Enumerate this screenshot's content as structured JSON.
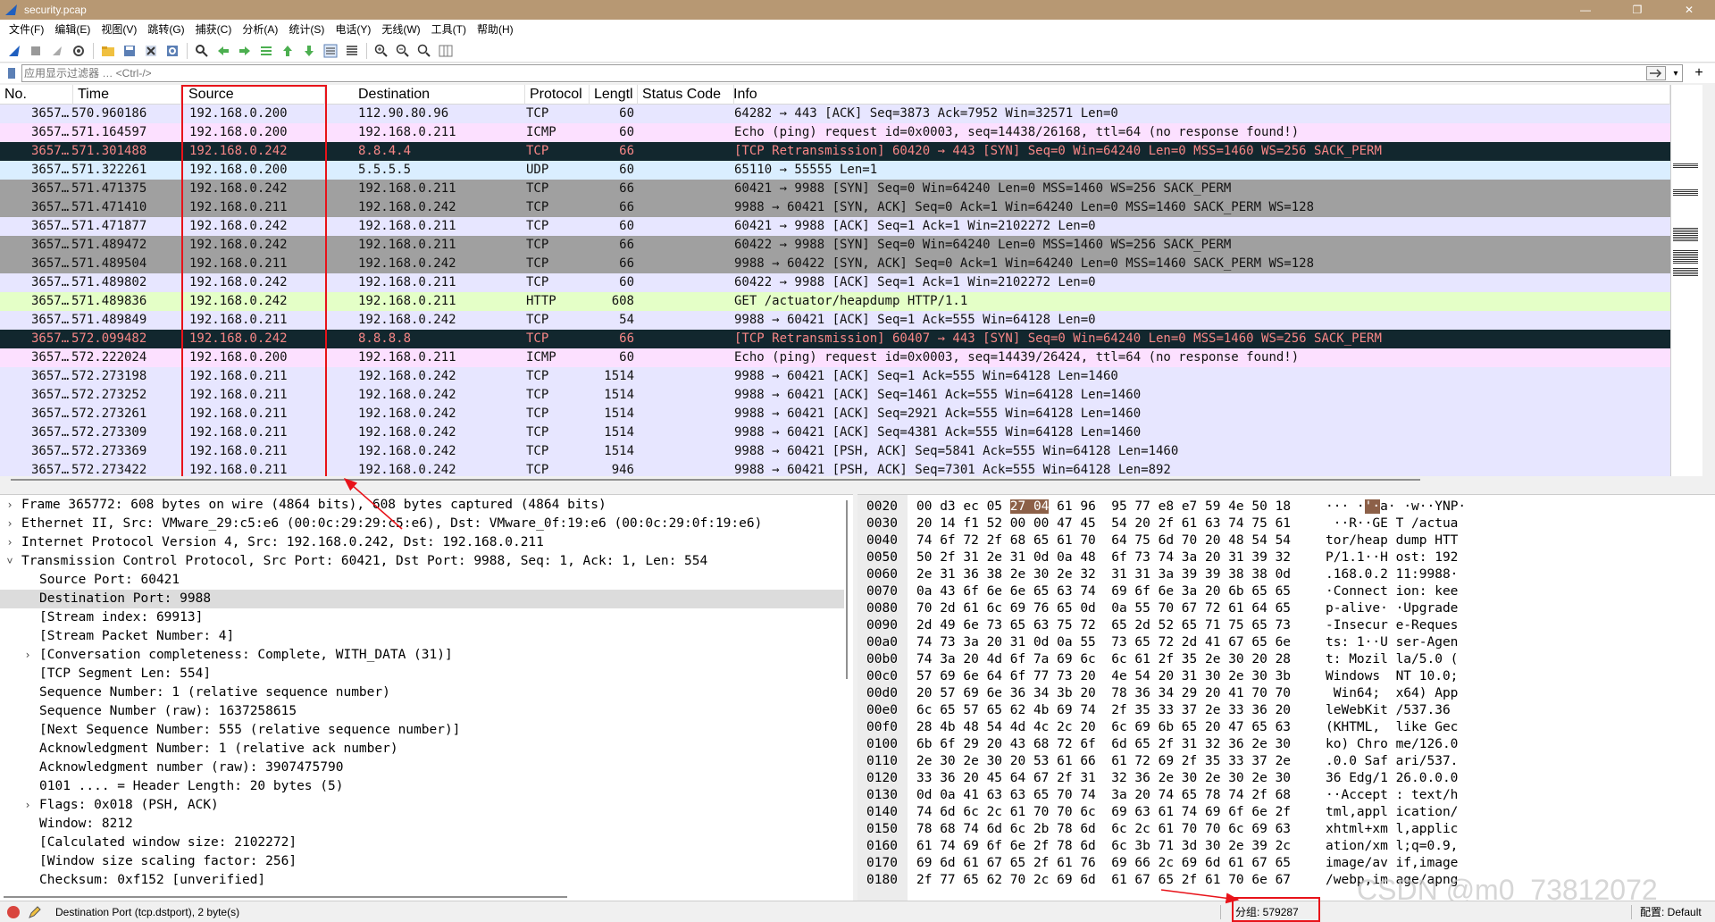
{
  "window": {
    "title": "security.pcap",
    "controls": [
      "—",
      "❐",
      "✕"
    ]
  },
  "menu": [
    "文件(F)",
    "编辑(E)",
    "视图(V)",
    "跳转(G)",
    "捕获(C)",
    "分析(A)",
    "统计(S)",
    "电话(Y)",
    "无线(W)",
    "工具(T)",
    "帮助(H)"
  ],
  "filter": {
    "placeholder": "应用显示过滤器 … <Ctrl-/>",
    "value": ""
  },
  "columns": [
    "No.",
    "Time",
    "Source",
    "Destination",
    "Protocol",
    "Lengtl",
    "Status Code",
    "Info"
  ],
  "packets": [
    {
      "no": "3657…",
      "time": "570.960186",
      "src": "192.168.0.200",
      "dst": "112.90.80.96",
      "proto": "TCP",
      "len": "60",
      "info": "64282 → 443 [ACK] Seq=3873 Ack=7952 Win=32571 Len=0",
      "style": "tcp"
    },
    {
      "no": "3657…",
      "time": "571.164597",
      "src": "192.168.0.200",
      "dst": "192.168.0.211",
      "proto": "ICMP",
      "len": "60",
      "info": "Echo (ping) request  id=0x0003, seq=14438/26168, ttl=64 (no response found!)",
      "style": "icmp"
    },
    {
      "no": "3657…",
      "time": "571.301488",
      "src": "192.168.0.242",
      "dst": "8.8.4.4",
      "proto": "TCP",
      "len": "66",
      "info": "[TCP Retransmission] 60420 → 443 [SYN] Seq=0 Win=64240 Len=0 MSS=1460 WS=256 SACK_PERM",
      "style": "bad"
    },
    {
      "no": "3657…",
      "time": "571.322261",
      "src": "192.168.0.200",
      "dst": "5.5.5.5",
      "proto": "UDP",
      "len": "60",
      "info": "65110 → 55555 Len=1",
      "style": "udp"
    },
    {
      "no": "3657…",
      "time": "571.471375",
      "src": "192.168.0.242",
      "dst": "192.168.0.211",
      "proto": "TCP",
      "len": "66",
      "info": "60421 → 9988 [SYN] Seq=0 Win=64240 Len=0 MSS=1460 WS=256 SACK_PERM",
      "style": "syn"
    },
    {
      "no": "3657…",
      "time": "571.471410",
      "src": "192.168.0.211",
      "dst": "192.168.0.242",
      "proto": "TCP",
      "len": "66",
      "info": "9988 → 60421 [SYN, ACK] Seq=0 Ack=1 Win=64240 Len=0 MSS=1460 SACK_PERM WS=128",
      "style": "syn"
    },
    {
      "no": "3657…",
      "time": "571.471877",
      "src": "192.168.0.242",
      "dst": "192.168.0.211",
      "proto": "TCP",
      "len": "60",
      "info": "60421 → 9988 [ACK] Seq=1 Ack=1 Win=2102272 Len=0",
      "style": "tcp"
    },
    {
      "no": "3657…",
      "time": "571.489472",
      "src": "192.168.0.242",
      "dst": "192.168.0.211",
      "proto": "TCP",
      "len": "66",
      "info": "60422 → 9988 [SYN] Seq=0 Win=64240 Len=0 MSS=1460 WS=256 SACK_PERM",
      "style": "syn"
    },
    {
      "no": "3657…",
      "time": "571.489504",
      "src": "192.168.0.211",
      "dst": "192.168.0.242",
      "proto": "TCP",
      "len": "66",
      "info": "9988 → 60422 [SYN, ACK] Seq=0 Ack=1 Win=64240 Len=0 MSS=1460 SACK_PERM WS=128",
      "style": "syn"
    },
    {
      "no": "3657…",
      "time": "571.489802",
      "src": "192.168.0.242",
      "dst": "192.168.0.211",
      "proto": "TCP",
      "len": "60",
      "info": "60422 → 9988 [ACK] Seq=1 Ack=1 Win=2102272 Len=0",
      "style": "tcp"
    },
    {
      "no": "3657…",
      "time": "571.489836",
      "src": "192.168.0.242",
      "dst": "192.168.0.211",
      "proto": "HTTP",
      "len": "608",
      "info": "GET /actuator/heapdump HTTP/1.1",
      "style": "http"
    },
    {
      "no": "3657…",
      "time": "571.489849",
      "src": "192.168.0.211",
      "dst": "192.168.0.242",
      "proto": "TCP",
      "len": "54",
      "info": "9988 → 60421 [ACK] Seq=1 Ack=555 Win=64128 Len=0",
      "style": "tcp"
    },
    {
      "no": "3657…",
      "time": "572.099482",
      "src": "192.168.0.242",
      "dst": "8.8.8.8",
      "proto": "TCP",
      "len": "66",
      "info": "[TCP Retransmission] 60407 → 443 [SYN] Seq=0 Win=64240 Len=0 MSS=1460 WS=256 SACK_PERM",
      "style": "bad"
    },
    {
      "no": "3657…",
      "time": "572.222024",
      "src": "192.168.0.200",
      "dst": "192.168.0.211",
      "proto": "ICMP",
      "len": "60",
      "info": "Echo (ping) request  id=0x0003, seq=14439/26424, ttl=64 (no response found!)",
      "style": "icmp"
    },
    {
      "no": "3657…",
      "time": "572.273198",
      "src": "192.168.0.211",
      "dst": "192.168.0.242",
      "proto": "TCP",
      "len": "1514",
      "info": "9988 → 60421 [ACK] Seq=1 Ack=555 Win=64128 Len=1460",
      "style": "tcp"
    },
    {
      "no": "3657…",
      "time": "572.273252",
      "src": "192.168.0.211",
      "dst": "192.168.0.242",
      "proto": "TCP",
      "len": "1514",
      "info": "9988 → 60421 [ACK] Seq=1461 Ack=555 Win=64128 Len=1460",
      "style": "tcp"
    },
    {
      "no": "3657…",
      "time": "572.273261",
      "src": "192.168.0.211",
      "dst": "192.168.0.242",
      "proto": "TCP",
      "len": "1514",
      "info": "9988 → 60421 [ACK] Seq=2921 Ack=555 Win=64128 Len=1460",
      "style": "tcp"
    },
    {
      "no": "3657…",
      "time": "572.273309",
      "src": "192.168.0.211",
      "dst": "192.168.0.242",
      "proto": "TCP",
      "len": "1514",
      "info": "9988 → 60421 [ACK] Seq=4381 Ack=555 Win=64128 Len=1460",
      "style": "tcp"
    },
    {
      "no": "3657…",
      "time": "572.273369",
      "src": "192.168.0.211",
      "dst": "192.168.0.242",
      "proto": "TCP",
      "len": "1514",
      "info": "9988 → 60421 [PSH, ACK] Seq=5841 Ack=555 Win=64128 Len=1460",
      "style": "tcp"
    },
    {
      "no": "3657…",
      "time": "572.273422",
      "src": "192.168.0.211",
      "dst": "192.168.0.242",
      "proto": "TCP",
      "len": "946",
      "info": "9988 → 60421 [PSH, ACK] Seq=7301 Ack=555 Win=64128 Len=892",
      "style": "tcp"
    }
  ],
  "details": [
    {
      "indent": 0,
      "expander": "›",
      "text": "Frame 365772: 608 bytes on wire (4864 bits), 608 bytes captured (4864 bits)"
    },
    {
      "indent": 0,
      "expander": "›",
      "text": "Ethernet II, Src: VMware_29:c5:e6 (00:0c:29:29:c5:e6), Dst: VMware_0f:19:e6 (00:0c:29:0f:19:e6)"
    },
    {
      "indent": 0,
      "expander": "›",
      "text": "Internet Protocol Version 4, Src: 192.168.0.242, Dst: 192.168.0.211"
    },
    {
      "indent": 0,
      "expander": "˅",
      "text": "Transmission Control Protocol, Src Port: 60421, Dst Port: 9988, Seq: 1, Ack: 1, Len: 554"
    },
    {
      "indent": 1,
      "expander": "",
      "text": "Source Port: 60421"
    },
    {
      "indent": 1,
      "expander": "",
      "text": "Destination Port: 9988",
      "selected": true
    },
    {
      "indent": 1,
      "expander": "",
      "text": "[Stream index: 69913]"
    },
    {
      "indent": 1,
      "expander": "",
      "text": "[Stream Packet Number: 4]"
    },
    {
      "indent": 1,
      "expander": "›",
      "text": "[Conversation completeness: Complete, WITH_DATA (31)]"
    },
    {
      "indent": 1,
      "expander": "",
      "text": "[TCP Segment Len: 554]"
    },
    {
      "indent": 1,
      "expander": "",
      "text": "Sequence Number: 1    (relative sequence number)"
    },
    {
      "indent": 1,
      "expander": "",
      "text": "Sequence Number (raw): 1637258615"
    },
    {
      "indent": 1,
      "expander": "",
      "text": "[Next Sequence Number: 555    (relative sequence number)]"
    },
    {
      "indent": 1,
      "expander": "",
      "text": "Acknowledgment Number: 1    (relative ack number)"
    },
    {
      "indent": 1,
      "expander": "",
      "text": "Acknowledgment number (raw): 3907475790"
    },
    {
      "indent": 1,
      "expander": "",
      "text": "0101 .... = Header Length: 20 bytes (5)"
    },
    {
      "indent": 1,
      "expander": "›",
      "text": "Flags: 0x018 (PSH, ACK)"
    },
    {
      "indent": 1,
      "expander": "",
      "text": "Window: 8212"
    },
    {
      "indent": 1,
      "expander": "",
      "text": "[Calculated window size: 2102272]"
    },
    {
      "indent": 1,
      "expander": "",
      "text": "[Window size scaling factor: 256]"
    },
    {
      "indent": 1,
      "expander": "",
      "text": "Checksum: 0xf152 [unverified]"
    }
  ],
  "hex": [
    {
      "offset": "0020",
      "pre": "00 d3 ec 05 ",
      "hl": "27 04",
      "post": " 61 96  95 77 e8 e7 59 4e 50 18",
      "apre": "··· ·",
      "ahl": "'·",
      "apost": "a· ·w··YNP·"
    },
    {
      "offset": "0030",
      "pre": "20 14 f1 52 00 00 47 45  54 20 2f 61 63 74 75 61",
      "hl": "",
      "post": "",
      "apre": " ··R··GE T /actua",
      "ahl": "",
      "apost": ""
    },
    {
      "offset": "0040",
      "pre": "74 6f 72 2f 68 65 61 70  64 75 6d 70 20 48 54 54",
      "hl": "",
      "post": "",
      "apre": "tor/heap dump HTT",
      "ahl": "",
      "apost": ""
    },
    {
      "offset": "0050",
      "pre": "50 2f 31 2e 31 0d 0a 48  6f 73 74 3a 20 31 39 32",
      "hl": "",
      "post": "",
      "apre": "P/1.1··H ost: 192",
      "ahl": "",
      "apost": ""
    },
    {
      "offset": "0060",
      "pre": "2e 31 36 38 2e 30 2e 32  31 31 3a 39 39 38 38 0d",
      "hl": "",
      "post": "",
      "apre": ".168.0.2 11:9988·",
      "ahl": "",
      "apost": ""
    },
    {
      "offset": "0070",
      "pre": "0a 43 6f 6e 6e 65 63 74  69 6f 6e 3a 20 6b 65 65",
      "hl": "",
      "post": "",
      "apre": "·Connect ion: kee",
      "ahl": "",
      "apost": ""
    },
    {
      "offset": "0080",
      "pre": "70 2d 61 6c 69 76 65 0d  0a 55 70 67 72 61 64 65",
      "hl": "",
      "post": "",
      "apre": "p-alive· ·Upgrade",
      "ahl": "",
      "apost": ""
    },
    {
      "offset": "0090",
      "pre": "2d 49 6e 73 65 63 75 72  65 2d 52 65 71 75 65 73",
      "hl": "",
      "post": "",
      "apre": "-Insecur e-Reques",
      "ahl": "",
      "apost": ""
    },
    {
      "offset": "00a0",
      "pre": "74 73 3a 20 31 0d 0a 55  73 65 72 2d 41 67 65 6e",
      "hl": "",
      "post": "",
      "apre": "ts: 1··U ser-Agen",
      "ahl": "",
      "apost": ""
    },
    {
      "offset": "00b0",
      "pre": "74 3a 20 4d 6f 7a 69 6c  6c 61 2f 35 2e 30 20 28",
      "hl": "",
      "post": "",
      "apre": "t: Mozil la/5.0 (",
      "ahl": "",
      "apost": ""
    },
    {
      "offset": "00c0",
      "pre": "57 69 6e 64 6f 77 73 20  4e 54 20 31 30 2e 30 3b",
      "hl": "",
      "post": "",
      "apre": "Windows  NT 10.0;",
      "ahl": "",
      "apost": ""
    },
    {
      "offset": "00d0",
      "pre": "20 57 69 6e 36 34 3b 20  78 36 34 29 20 41 70 70",
      "hl": "",
      "post": "",
      "apre": " Win64;  x64) App",
      "ahl": "",
      "apost": ""
    },
    {
      "offset": "00e0",
      "pre": "6c 65 57 65 62 4b 69 74  2f 35 33 37 2e 33 36 20",
      "hl": "",
      "post": "",
      "apre": "leWebKit /537.36 ",
      "ahl": "",
      "apost": ""
    },
    {
      "offset": "00f0",
      "pre": "28 4b 48 54 4d 4c 2c 20  6c 69 6b 65 20 47 65 63",
      "hl": "",
      "post": "",
      "apre": "(KHTML,  like Gec",
      "ahl": "",
      "apost": ""
    },
    {
      "offset": "0100",
      "pre": "6b 6f 29 20 43 68 72 6f  6d 65 2f 31 32 36 2e 30",
      "hl": "",
      "post": "",
      "apre": "ko) Chro me/126.0",
      "ahl": "",
      "apost": ""
    },
    {
      "offset": "0110",
      "pre": "2e 30 2e 30 20 53 61 66  61 72 69 2f 35 33 37 2e",
      "hl": "",
      "post": "",
      "apre": ".0.0 Saf ari/537.",
      "ahl": "",
      "apost": ""
    },
    {
      "offset": "0120",
      "pre": "33 36 20 45 64 67 2f 31  32 36 2e 30 2e 30 2e 30",
      "hl": "",
      "post": "",
      "apre": "36 Edg/1 26.0.0.0",
      "ahl": "",
      "apost": ""
    },
    {
      "offset": "0130",
      "pre": "0d 0a 41 63 63 65 70 74  3a 20 74 65 78 74 2f 68",
      "hl": "",
      "post": "",
      "apre": "··Accept : text/h",
      "ahl": "",
      "apost": ""
    },
    {
      "offset": "0140",
      "pre": "74 6d 6c 2c 61 70 70 6c  69 63 61 74 69 6f 6e 2f",
      "hl": "",
      "post": "",
      "apre": "tml,appl ication/",
      "ahl": "",
      "apost": ""
    },
    {
      "offset": "0150",
      "pre": "78 68 74 6d 6c 2b 78 6d  6c 2c 61 70 70 6c 69 63",
      "hl": "",
      "post": "",
      "apre": "xhtml+xm l,applic",
      "ahl": "",
      "apost": ""
    },
    {
      "offset": "0160",
      "pre": "61 74 69 6f 6e 2f 78 6d  6c 3b 71 3d 30 2e 39 2c",
      "hl": "",
      "post": "",
      "apre": "ation/xm l;q=0.9,",
      "ahl": "",
      "apost": ""
    },
    {
      "offset": "0170",
      "pre": "69 6d 61 67 65 2f 61 76  69 66 2c 69 6d 61 67 65",
      "hl": "",
      "post": "",
      "apre": "image/av if,image",
      "ahl": "",
      "apost": ""
    },
    {
      "offset": "0180",
      "pre": "2f 77 65 62 70 2c 69 6d  61 67 65 2f 61 70 6e 67",
      "hl": "",
      "post": "",
      "apre": "/webp,im age/apng",
      "ahl": "",
      "apost": ""
    }
  ],
  "status": {
    "field": "Destination Port (tcp.dstport), 2 byte(s)",
    "packets": "分组: 579287",
    "profile": "配置: Default"
  },
  "watermark": "CSDN @m0_73812072",
  "colors": {
    "title_bar": "#b79873",
    "tcp_row": "#e7e6ff",
    "icmp_row": "#fce0ff",
    "udp_row": "#daeeff",
    "http_row": "#e4ffc7",
    "syn_row": "#a0a0a0",
    "bad_row": "#12272e",
    "annotation": "#e8131a"
  }
}
